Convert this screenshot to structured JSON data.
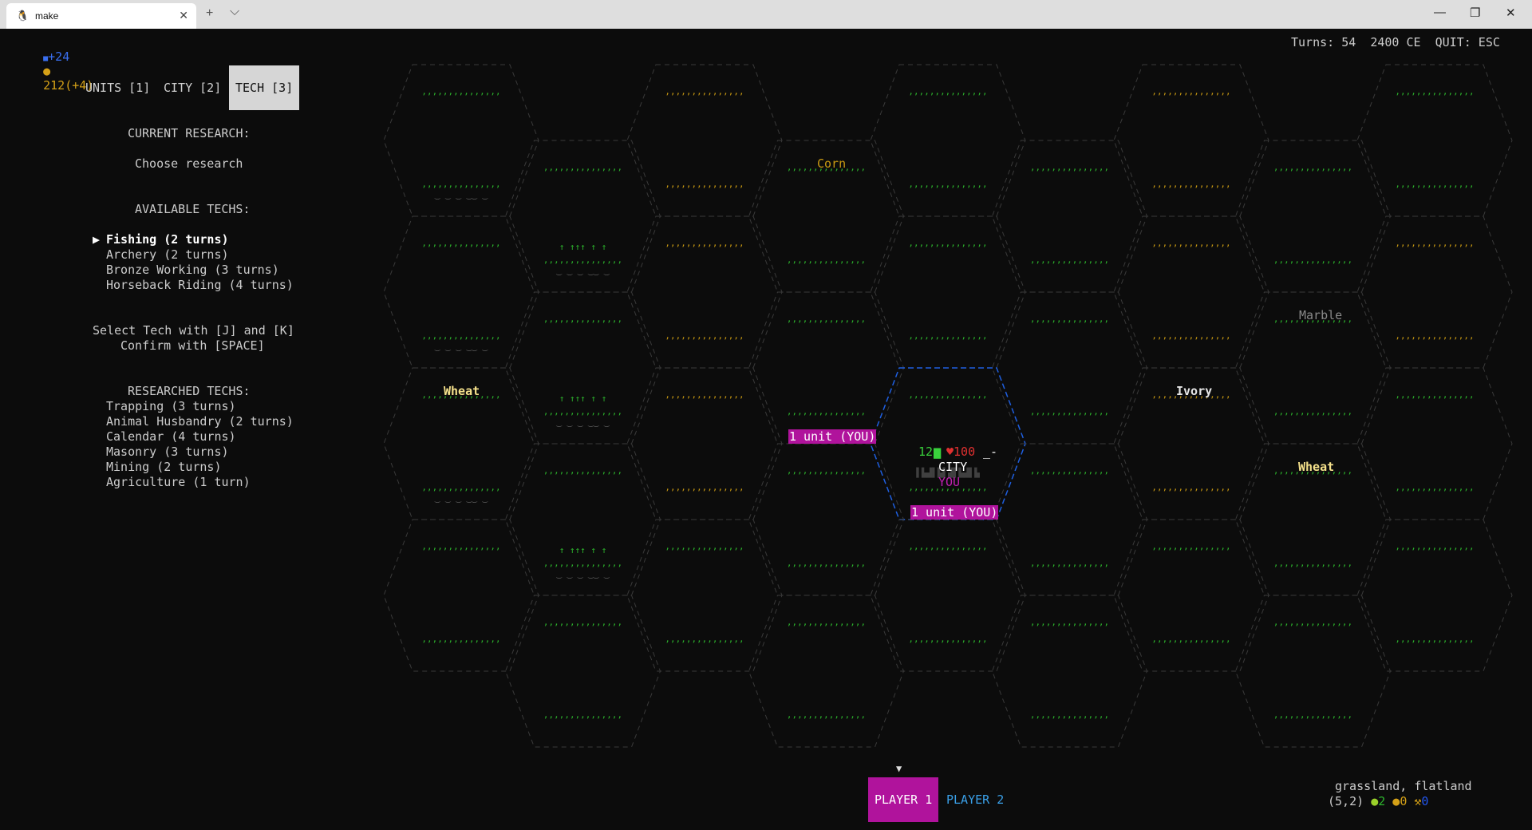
{
  "window": {
    "title": "make",
    "new_tab": "+",
    "dropdown": "⌵",
    "close_tab": "✕",
    "minimize": "—",
    "restore": "❐",
    "close": "✕"
  },
  "hud": {
    "science": "+24",
    "gold": "212(+4)",
    "turns": "Turns: 54",
    "year": "2400 CE",
    "quit": "QUIT: ESC"
  },
  "tabs": [
    {
      "label": "UNITS [1]",
      "active": false
    },
    {
      "label": "CITY [2]",
      "active": false
    },
    {
      "label": "TECH [3]",
      "active": true
    }
  ],
  "research": {
    "current_header": "CURRENT RESEARCH:",
    "current": "Choose research",
    "available_header": "AVAILABLE TECHS:",
    "selected_marker": "▶",
    "available": [
      "Fishing (2 turns)",
      "Archery (2 turns)",
      "Bronze Working (3 turns)",
      "Horseback Riding (4 turns)"
    ],
    "help_select": "Select Tech with [J] and [K]",
    "help_confirm": "Confirm with [SPACE]",
    "researched_header": "RESEARCHED TECHS:",
    "researched": [
      "Trapping (3 turns)",
      "Animal Husbandry (2 turns)",
      "Calendar (4 turns)",
      "Masonry (3 turns)",
      "Mining (2 turns)",
      "Agriculture (1 turn)"
    ]
  },
  "map": {
    "resources": {
      "corn": "Corn",
      "wheat1": "Wheat",
      "ivory": "Ivory",
      "marble": "Marble",
      "wheat2": "Wheat"
    },
    "units": {
      "unit_a": "1 unit (YOU)",
      "unit_b": "1 unit (YOU)"
    },
    "city": {
      "population": "12",
      "health": "♥100",
      "marker": "_-",
      "name": "CITY",
      "owner": "YOU"
    }
  },
  "players": {
    "marker": "▼",
    "p1": "PLAYER 1",
    "p2": "PLAYER 2"
  },
  "tile_info": {
    "terrain": "grassland, flatland",
    "coords": "(5,2)",
    "food": "2",
    "gold": "0",
    "production": "0"
  },
  "colors": {
    "background": "#0c0c0c",
    "grass": "#2db52d",
    "desert": "#c99a12",
    "resource": "#f5e18b",
    "unit_badge": "#b0139c",
    "city_outline": "#1f5fe0",
    "player2": "#3aa0e8"
  }
}
